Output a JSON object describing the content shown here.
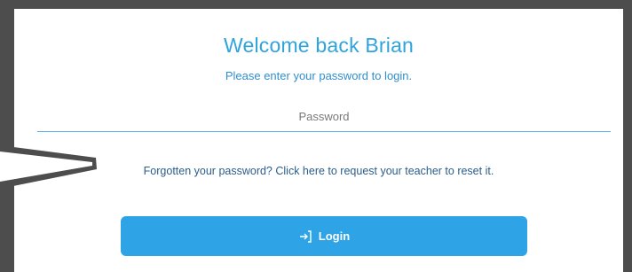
{
  "header": {
    "title": "Welcome back Brian",
    "subtitle": "Please enter your password to login."
  },
  "password": {
    "placeholder": "Password",
    "value": ""
  },
  "forgot": {
    "text": "Forgotten your password? Click here to request your teacher to reset it."
  },
  "login": {
    "label": "Login",
    "icon": "login-arrow-icon"
  },
  "colors": {
    "accent": "#2ea3e6",
    "link": "#2b5d8c",
    "frame": "#4d4d4d"
  }
}
